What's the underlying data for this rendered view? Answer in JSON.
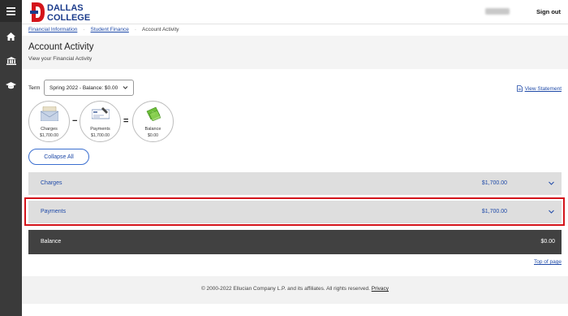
{
  "header": {
    "logo_line1": "DALLAS",
    "logo_line2": "COLLEGE",
    "signout": "Sign out"
  },
  "nav_icons": [
    "menu-icon",
    "home-icon",
    "bank-icon",
    "graduation-cap-icon"
  ],
  "breadcrumb": {
    "items": [
      "Financial Information",
      "Student Finance",
      "Account Activity"
    ],
    "separator": "·"
  },
  "page": {
    "title": "Account Activity",
    "subtitle": "View your Financial Activity"
  },
  "term": {
    "label": "Term",
    "selected": "Spring 2022 - Balance: $0.00"
  },
  "view_statement": "View Statement",
  "summary": {
    "charges": {
      "label": "Charges",
      "amount": "$1,700.00"
    },
    "payments": {
      "label": "Payments",
      "amount": "$1,700.00"
    },
    "balance": {
      "label": "Balance",
      "amount": "$0.00"
    },
    "minus": "−",
    "equals": "="
  },
  "collapse_all": "Collapse All",
  "rows": {
    "charges": {
      "label": "Charges",
      "amount": "$1,700.00"
    },
    "payments": {
      "label": "Payments",
      "amount": "$1,700.00"
    },
    "balance": {
      "label": "Balance",
      "amount": "$0.00"
    }
  },
  "top_of_page": "Top of page",
  "footer": {
    "text": "© 2000-2022 Ellucian Company L.P. and its affiliates. All rights reserved.",
    "privacy": "Privacy"
  },
  "colors": {
    "brand_blue": "#1f4aa8",
    "logo_red": "#d4141b",
    "logo_navy": "#1c3c8c",
    "highlight": "#d4141b"
  }
}
